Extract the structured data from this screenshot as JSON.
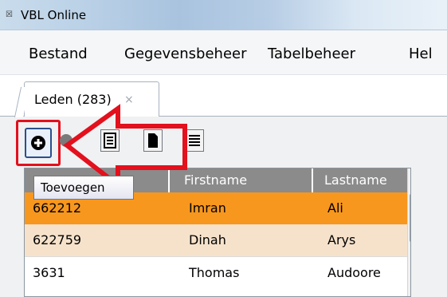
{
  "window": {
    "title": "VBL Online",
    "icon": "app-icon"
  },
  "menu": {
    "items": [
      "Bestand",
      "Gegevensbeheer",
      "Tabelbeheer",
      "Hel"
    ]
  },
  "tab": {
    "label": "Leden (283)",
    "close": "×"
  },
  "toolbar": {
    "add_icon": "plus-circle-icon",
    "buttons": [
      "add-button",
      "delete-button",
      "detail-button",
      "document-button",
      "list-button"
    ]
  },
  "tooltip": {
    "text": "Toevoegen"
  },
  "grid": {
    "columns": [
      "",
      "Firstname",
      "Lastname"
    ],
    "rows": [
      {
        "id": "662212",
        "firstname": "Imran",
        "lastname": "Ali",
        "state": "selected"
      },
      {
        "id": "622759",
        "firstname": "Dinah",
        "lastname": "Arys",
        "state": "alternate"
      },
      {
        "id": "3631",
        "firstname": "Thomas",
        "lastname": "Audoore",
        "state": "normal"
      }
    ]
  },
  "colors": {
    "annotation_red": "#e3101d",
    "selected_row": "#f7971e",
    "alternate_row": "#f6e2cb",
    "header_gray": "#8b8b8b"
  }
}
